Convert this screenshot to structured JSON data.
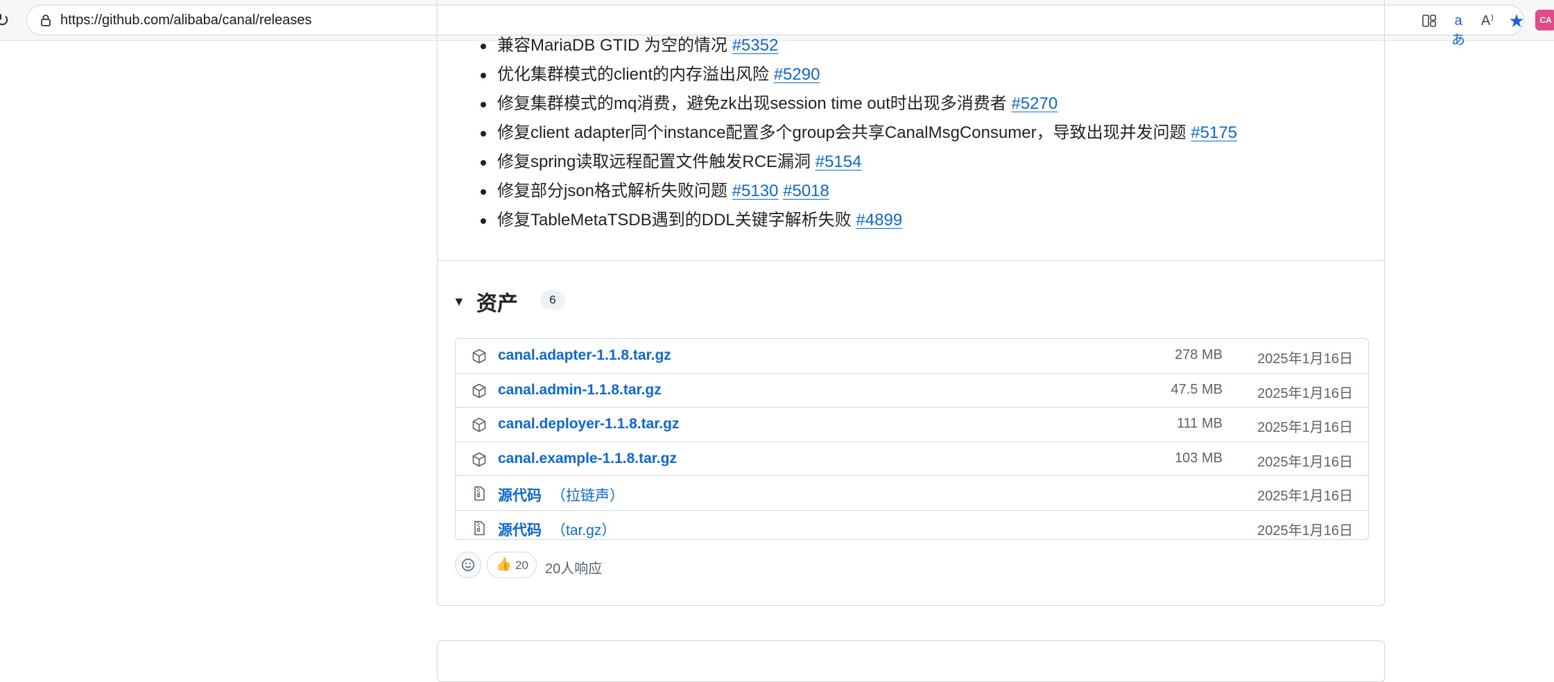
{
  "browser": {
    "url": "https://github.com/alibaba/canal/releases",
    "extension_badge": "CA"
  },
  "release_notes": [
    {
      "text": "兼容MariaDB GTID 为空的情况",
      "links": [
        "#5352"
      ]
    },
    {
      "text": "优化集群模式的client的内存溢出风险",
      "links": [
        "#5290"
      ]
    },
    {
      "text": "修复集群模式的mq消费，避免zk出现session time out时出现多消费者",
      "links": [
        "#5270"
      ]
    },
    {
      "text": "修复client adapter同个instance配置多个group会共享CanalMsgConsumer，导致出现并发问题",
      "links": [
        "#5175"
      ]
    },
    {
      "text": "修复spring读取远程配置文件触发RCE漏洞",
      "links": [
        "#5154"
      ]
    },
    {
      "text": "修复部分json格式解析失败问题",
      "links": [
        "#5130",
        "#5018"
      ]
    },
    {
      "text": "修复TableMetaTSDB遇到的DDL关键字解析失败",
      "links": [
        "#4899"
      ]
    }
  ],
  "assets": {
    "title": "资产",
    "count": "6",
    "items": [
      {
        "icon": "package-icon",
        "name": "canal.adapter-1.1.8.tar.gz",
        "sub": "",
        "size": "278 MB",
        "date": "2025年1月16日"
      },
      {
        "icon": "package-icon",
        "name": "canal.admin-1.1.8.tar.gz",
        "sub": "",
        "size": "47.5 MB",
        "date": "2025年1月16日"
      },
      {
        "icon": "package-icon",
        "name": "canal.deployer-1.1.8.tar.gz",
        "sub": "",
        "size": "111 MB",
        "date": "2025年1月16日"
      },
      {
        "icon": "package-icon",
        "name": "canal.example-1.1.8.tar.gz",
        "sub": "",
        "size": "103 MB",
        "date": "2025年1月16日"
      },
      {
        "icon": "file-zip-icon",
        "name": "源代码",
        "sub": "（拉链声）",
        "size": "",
        "date": "2025年1月16日"
      },
      {
        "icon": "file-zip-icon",
        "name": "源代码",
        "sub": "（tar.gz）",
        "size": "",
        "date": "2025年1月16日"
      }
    ]
  },
  "reactions": {
    "emoji": "👍",
    "count": "20",
    "summary": "20人响应"
  }
}
